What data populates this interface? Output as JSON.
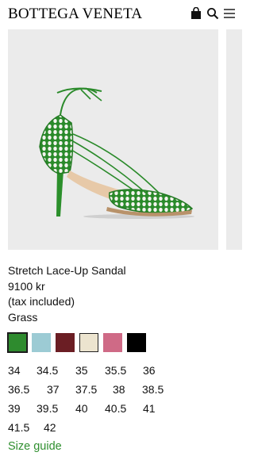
{
  "header": {
    "brand": "BOTTEGA VENETA",
    "icons": [
      "shopping-bag-icon",
      "search-icon",
      "menu-icon"
    ]
  },
  "product": {
    "name": "Stretch Lace-Up Sandal",
    "price": "9100 kr",
    "tax_note": "(tax included)",
    "color_name": "Grass"
  },
  "colors": {
    "swatches": [
      {
        "name": "Grass",
        "hex": "#2e8b2e",
        "selected": true
      },
      {
        "name": "",
        "hex": "#9ccbd4",
        "selected": false
      },
      {
        "name": "",
        "hex": "#6b1e24",
        "selected": false
      },
      {
        "name": "",
        "hex": "#ece4cf",
        "selected": false
      },
      {
        "name": "",
        "hex": "#cf6a86",
        "selected": false
      },
      {
        "name": "",
        "hex": "#000000",
        "selected": false
      }
    ],
    "accent_link": "#2f8f2f",
    "image_background": "#ebebeb"
  },
  "sizes": [
    [
      "34",
      "34.5",
      "35",
      "35.5",
      "36"
    ],
    [
      "36.5",
      "37",
      "37.5",
      "38",
      "38.5"
    ],
    [
      "39",
      "39.5",
      "40",
      "40.5",
      "41"
    ],
    [
      "41.5",
      "42"
    ]
  ],
  "size_guide_label": "Size guide"
}
